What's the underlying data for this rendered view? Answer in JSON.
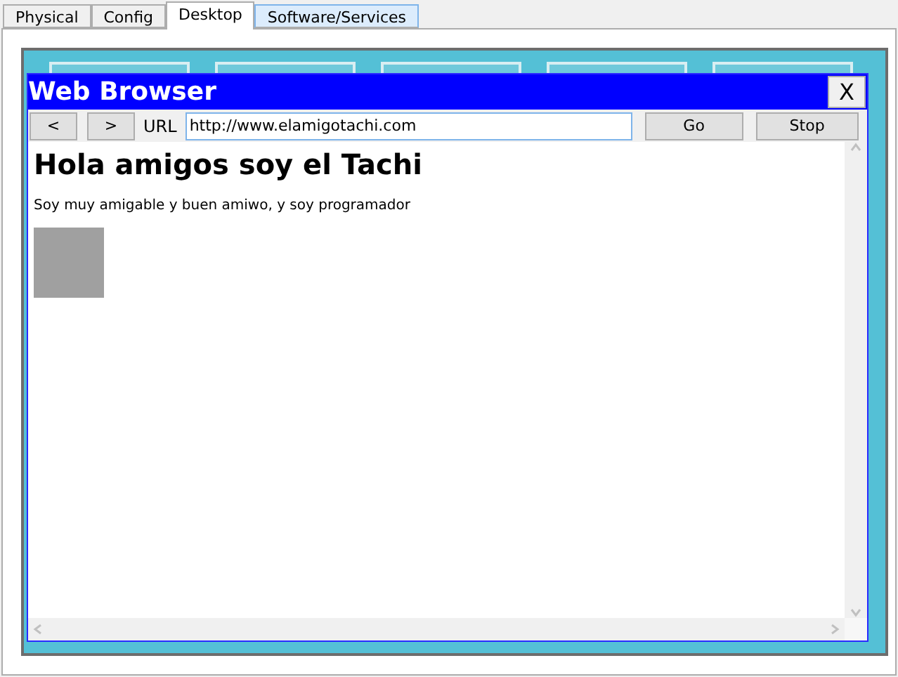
{
  "tabs": [
    {
      "label": "Physical",
      "selected": false
    },
    {
      "label": "Config",
      "selected": false
    },
    {
      "label": "Desktop",
      "selected": true
    },
    {
      "label": "Software/Services",
      "selected": false
    }
  ],
  "browser": {
    "title": "Web Browser",
    "close": "X",
    "back": "<",
    "forward": ">",
    "url_label": "URL",
    "url": "http://www.elamigotachi.com",
    "go": "Go",
    "stop": "Stop",
    "page": {
      "heading": "Hola amigos soy el Tachi",
      "text": "Soy muy amigable y buen amiwo, y soy programador",
      "image": {
        "kind": "placeholder"
      }
    }
  }
}
